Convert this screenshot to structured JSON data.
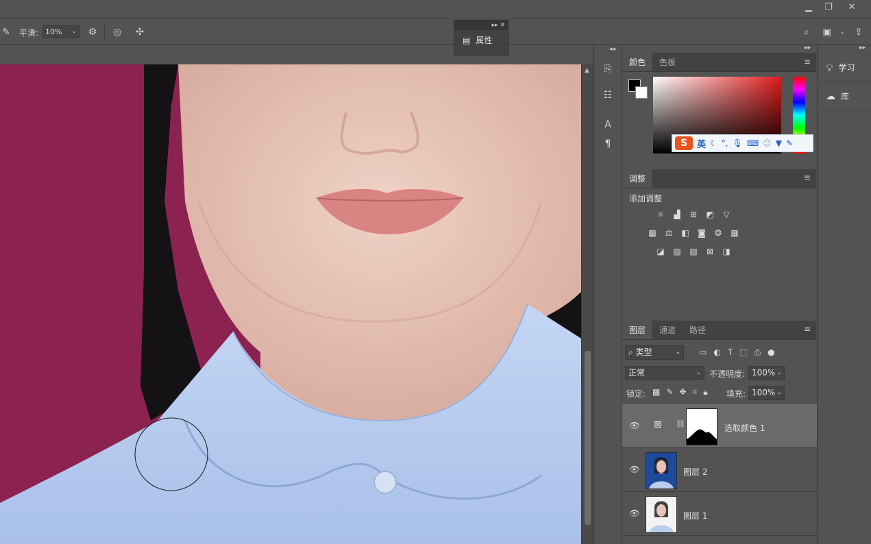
{
  "options_bar": {
    "smooth_label": "平滑:",
    "smooth_value": "10%"
  },
  "properties_float": {
    "label": "属性"
  },
  "color_panel": {
    "tabs": [
      "颜色",
      "色板"
    ],
    "foreground": "#000000",
    "background": "#ffffff"
  },
  "ime_toolbar": {
    "lang": "英"
  },
  "adjustments_panel": {
    "tab": "调整",
    "title": "添加调整"
  },
  "layers_panel": {
    "tabs": [
      "图层",
      "通道",
      "路径"
    ],
    "filter_label": "类型",
    "blend_mode": "正常",
    "opacity_label": "不透明度:",
    "opacity_value": "100%",
    "lock_label": "锁定:",
    "fill_label": "填充:",
    "fill_value": "100%",
    "layers": [
      {
        "name": "选取颜色 1",
        "type": "adjustment",
        "selected": true
      },
      {
        "name": "图层 2",
        "type": "photo-blue"
      },
      {
        "name": "图层 1",
        "type": "photo-white"
      }
    ]
  },
  "learn_panel": {
    "items": [
      "学习",
      "库"
    ]
  },
  "colors": {
    "canvas_background": "#8c2250",
    "shirt": "#b9cdee",
    "skin": "#e8c4b8",
    "hair": "#141214"
  }
}
